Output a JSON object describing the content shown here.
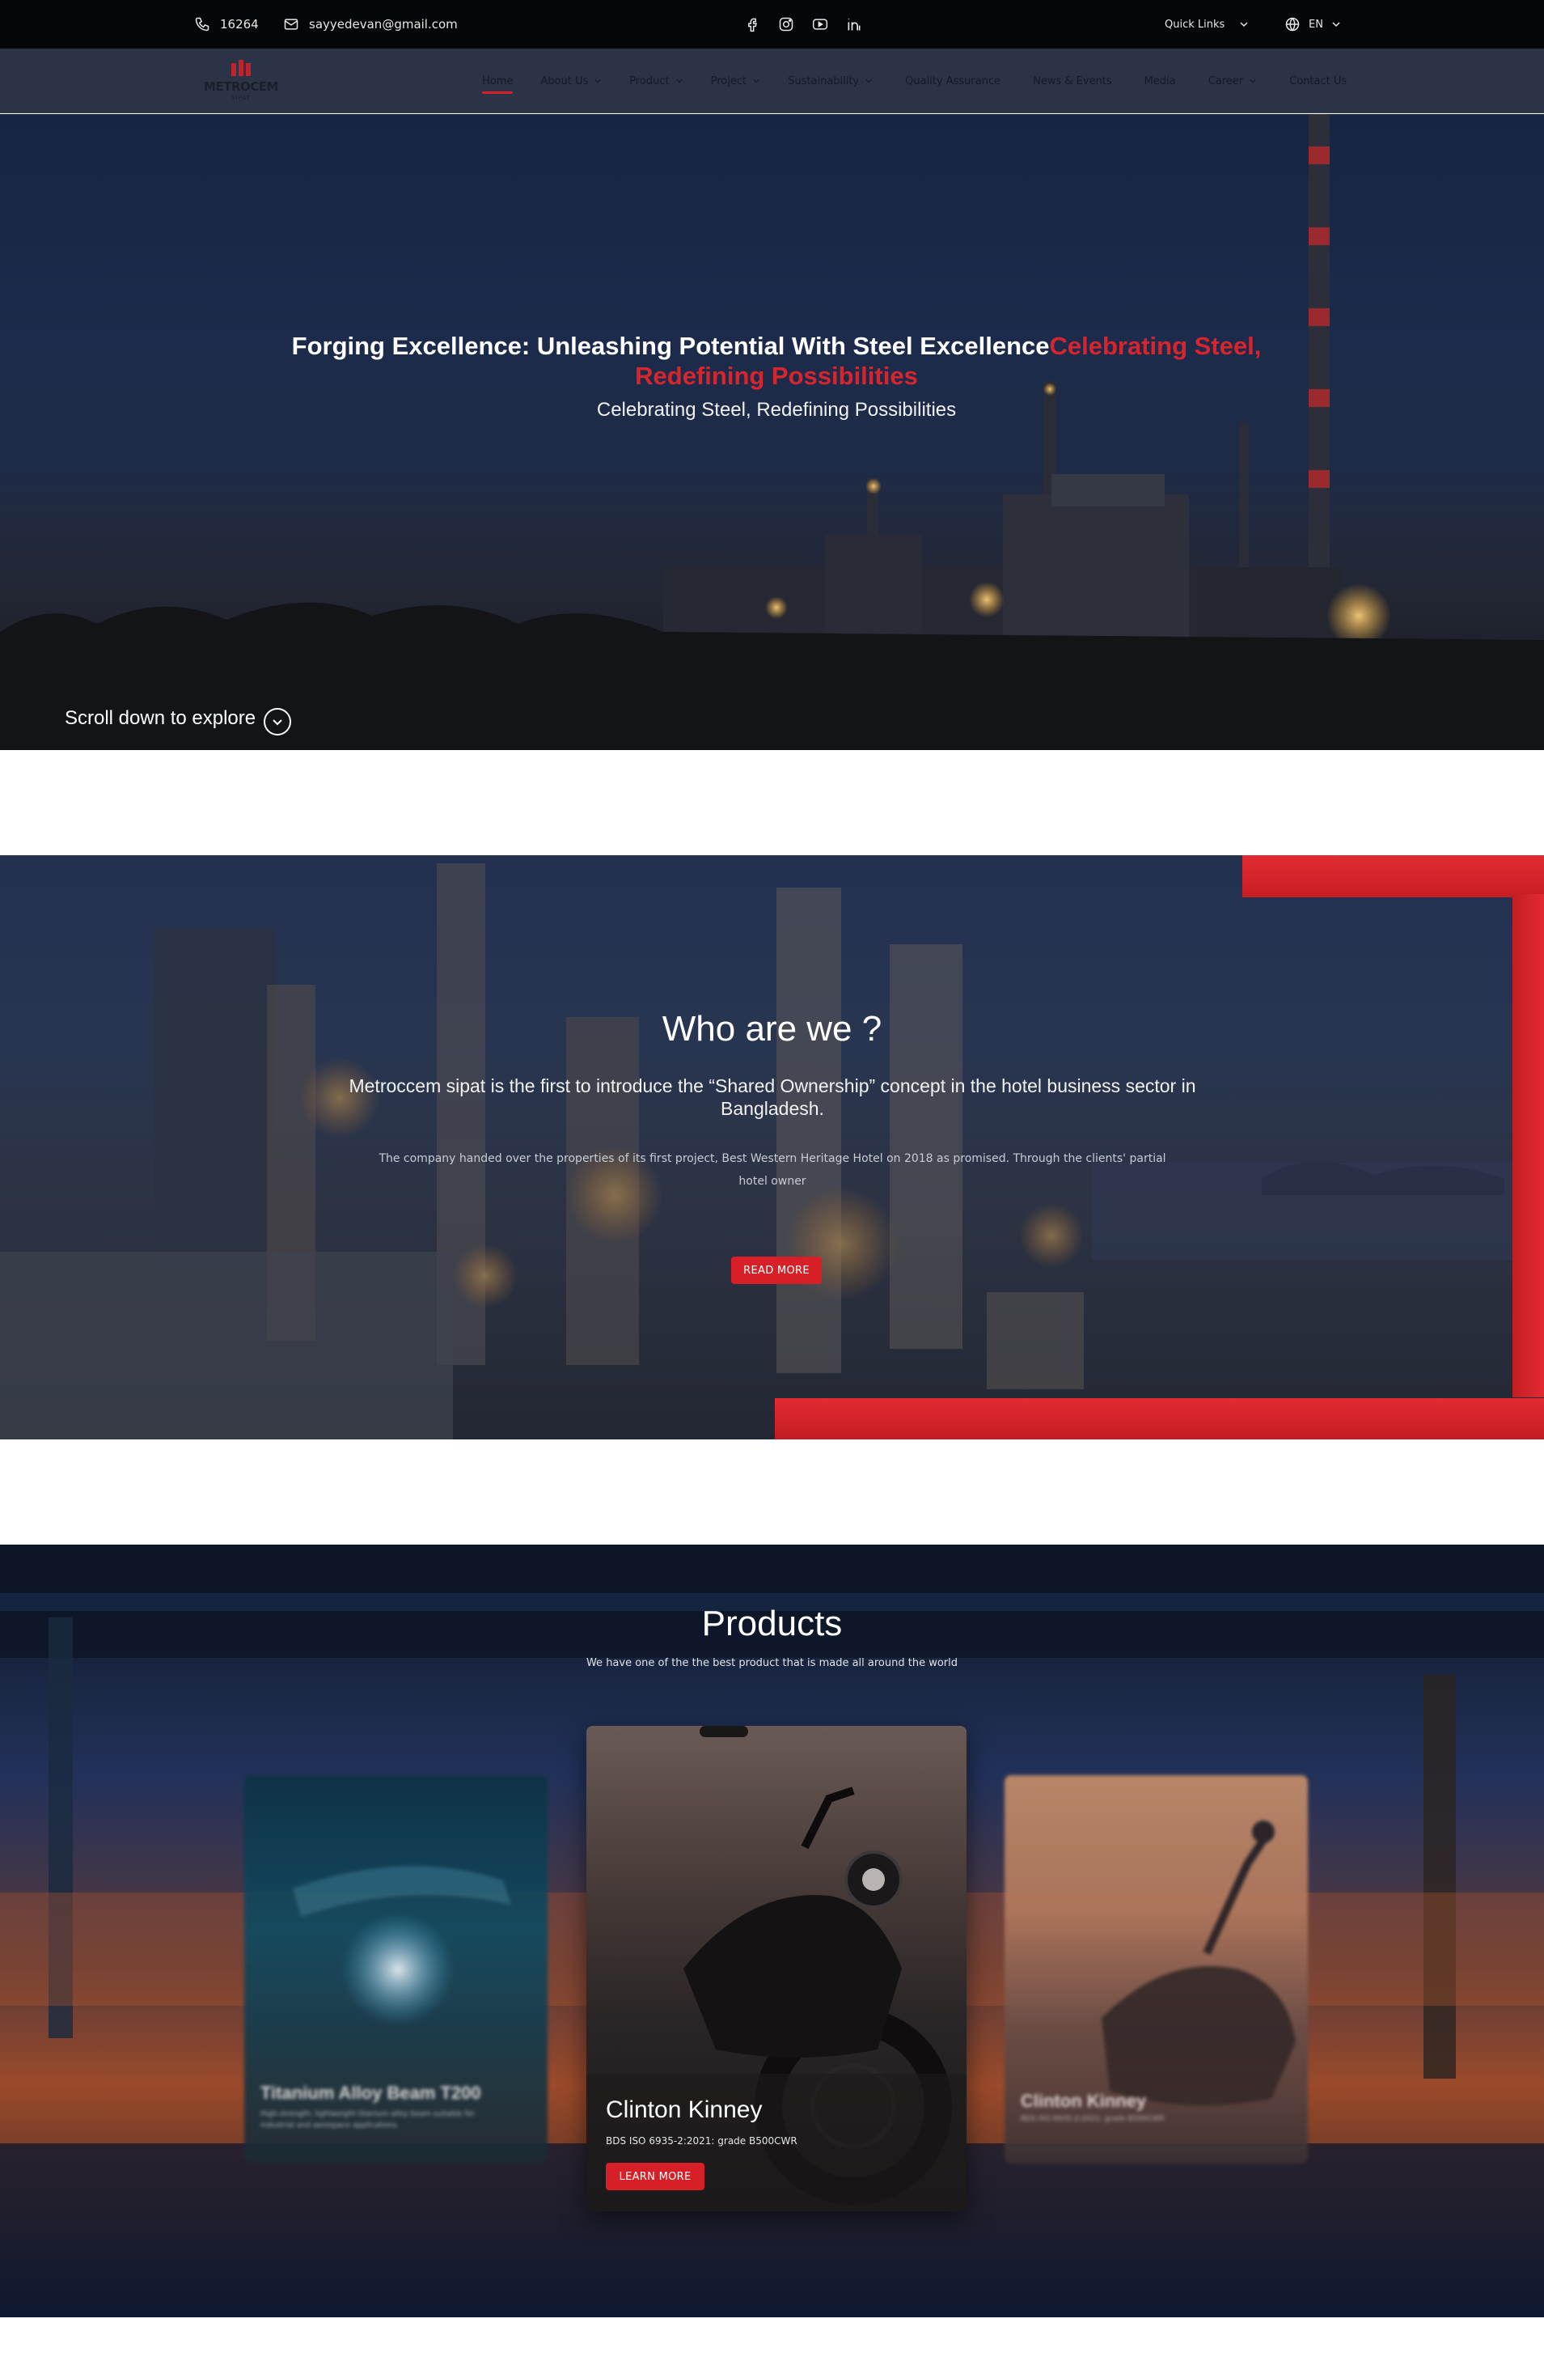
{
  "topbar": {
    "phone": "16264",
    "email": "sayyedevan@gmail.com",
    "social_icons": [
      "facebook-icon",
      "instagram-icon",
      "youtube-icon",
      "linkedin-icon"
    ],
    "quick_links": "Quick Links",
    "language": "EN"
  },
  "logo": {
    "name": "METROCEM",
    "sub": "SIPAT"
  },
  "nav": {
    "items": [
      {
        "label": "Home",
        "dropdown": false,
        "active": true
      },
      {
        "label": "About Us",
        "dropdown": true
      },
      {
        "label": "Product",
        "dropdown": true
      },
      {
        "label": "Project",
        "dropdown": true
      },
      {
        "label": "Sustainability",
        "dropdown": true
      },
      {
        "label": "Quality Assurance",
        "dropdown": false
      },
      {
        "label": "News & Events",
        "dropdown": false
      },
      {
        "label": "Media",
        "dropdown": false
      },
      {
        "label": "Career",
        "dropdown": true
      },
      {
        "label": "Contact Us",
        "dropdown": false
      }
    ]
  },
  "hero": {
    "title": "Forging Excellence: Unleashing Potential With Steel Excellence",
    "title_accent": "Celebrating Steel, Redefining Possibilities",
    "subtitle": "Celebrating Steel, Redefining Possibilities",
    "scroll_hint": "Scroll down to explore"
  },
  "about": {
    "title": "Who are we ?",
    "lead": "Metroccem sipat is the first to introduce the “Shared Ownership” concept in the hotel business sector in Bangladesh.",
    "body": "The company handed over the properties of its first project, Best Western Heritage Hotel on 2018 as promised. Through the clients' partial hotel owner",
    "button": "READ MORE"
  },
  "products": {
    "title": "Products",
    "subtitle": "We have one of the the best product that is made all around the world",
    "cards": [
      {
        "name": "Titanium Alloy Beam T200",
        "desc": "High-strength, lightweight titanium alloy beam suitable for industrial and aerospace applications."
      },
      {
        "name": "Clinton Kinney",
        "desc": "BDS ISO 6935-2:2021: grade B500CWR",
        "button": "LEARN MORE"
      },
      {
        "name": "Clinton Kinney",
        "desc": "BDS ISO 6935-2:2021: grade B500CWR"
      }
    ]
  },
  "colors": {
    "accent_red": "#d71f27",
    "topbar_bg": "#050608",
    "nav_bg": "#2b3347"
  }
}
